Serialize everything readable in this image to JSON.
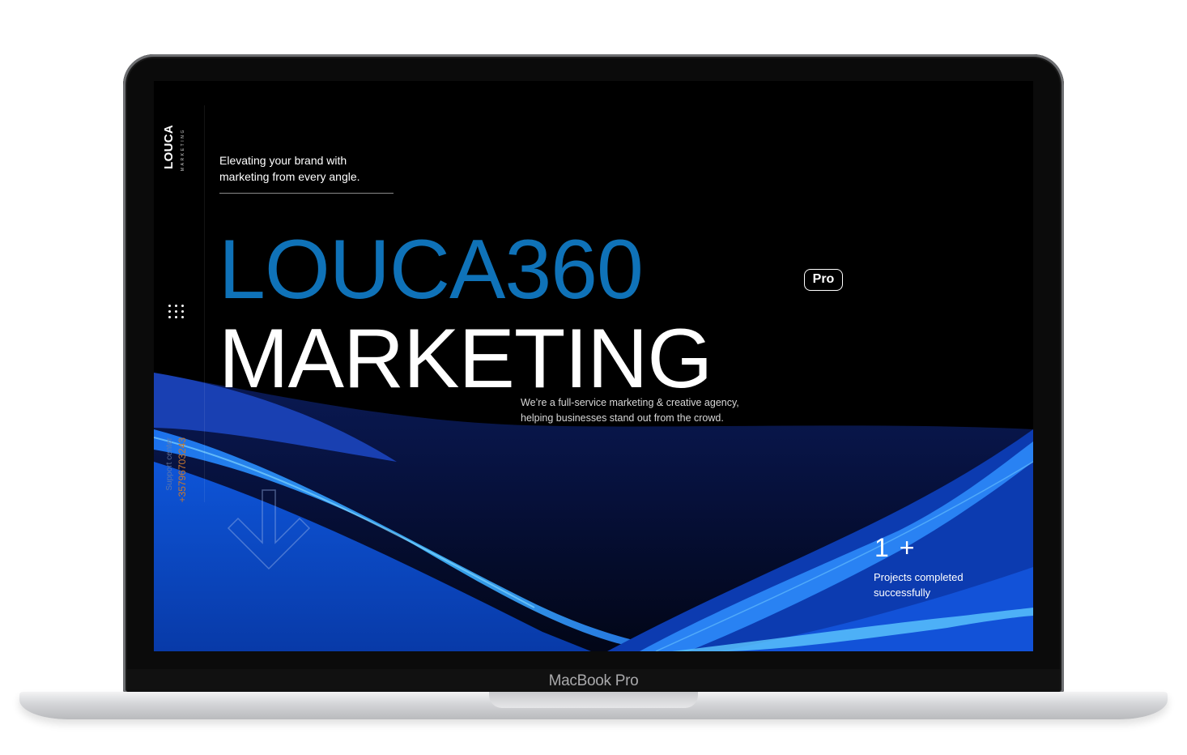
{
  "device": {
    "model_label": "MacBook Pro"
  },
  "site": {
    "logo": {
      "name": "LOUCA",
      "mark": "®",
      "subtitle": "MARKETING"
    },
    "menu_icon": "grid-dots-icon",
    "tagline_line1": "Elevating your brand with",
    "tagline_line2": "marketing from every angle.",
    "hero": {
      "line1": "LOUCA360",
      "line2": "MARKETING"
    },
    "badge": "Pro",
    "description_line1": "We’re a full-service marketing & creative agency,",
    "description_line2": "helping businesses stand out from the crowd.",
    "support": {
      "label": "Support center",
      "phone": "+35796703243"
    },
    "scroll_icon": "arrow-down-icon",
    "stat": {
      "value": "1 +",
      "label_line1": "Projects completed",
      "label_line2": "successfully"
    },
    "colors": {
      "brand_blue": "#0f72b8",
      "background": "#000000",
      "wave_light": "#3fb6ff",
      "wave_dark": "#0a2f8f",
      "phone_accent": "#c9782d"
    }
  }
}
